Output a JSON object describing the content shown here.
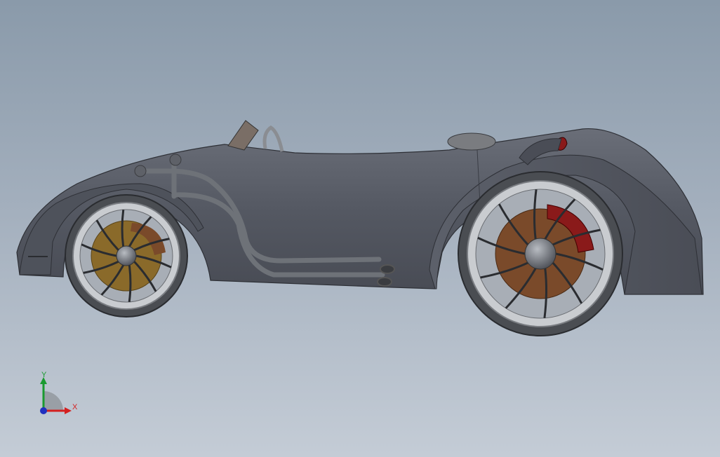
{
  "viewport": {
    "background_top": "#8a9aaa",
    "background_bottom": "#c4ccd6"
  },
  "model": {
    "body_color": "#5a5e68",
    "body_dark": "#3e4149",
    "rim_color": "#c9ccd0",
    "tire_color": "#4a4d52",
    "disc_front_color": "#8a6a2a",
    "disc_rear_color": "#7a4a2a",
    "caliper_color": "#8a1a1a",
    "exhaust_color": "#6e7278"
  },
  "triad": {
    "x_label": "X",
    "y_label": "Y",
    "x_color": "#d42020",
    "y_color": "#1a9a30",
    "z_color": "#2030c0"
  }
}
